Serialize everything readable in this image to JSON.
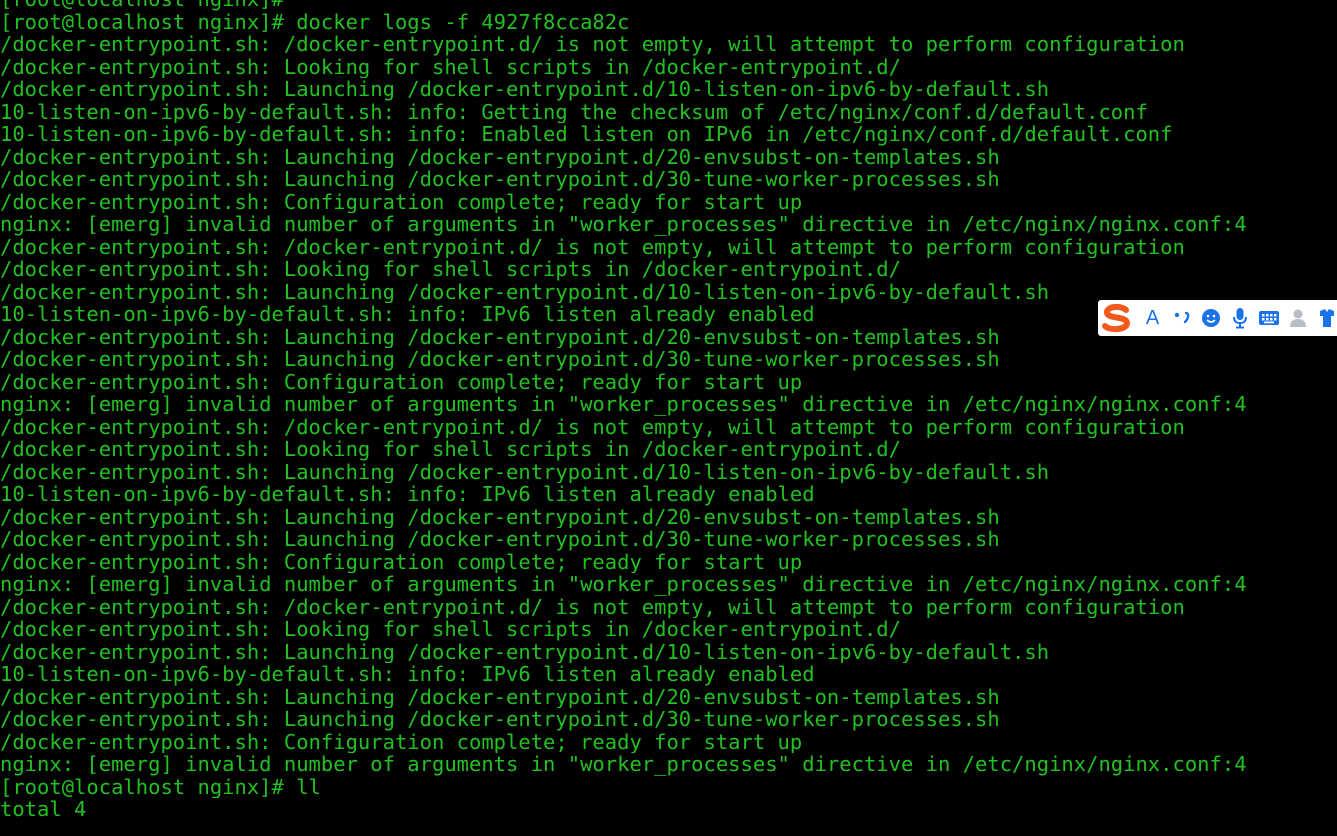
{
  "terminal": {
    "text_color": "#22c022",
    "background_color": "#000000",
    "lines": [
      "[root@localhost nginx]#",
      "[root@localhost nginx]# docker logs -f 4927f8cca82c",
      "/docker-entrypoint.sh: /docker-entrypoint.d/ is not empty, will attempt to perform configuration",
      "/docker-entrypoint.sh: Looking for shell scripts in /docker-entrypoint.d/",
      "/docker-entrypoint.sh: Launching /docker-entrypoint.d/10-listen-on-ipv6-by-default.sh",
      "10-listen-on-ipv6-by-default.sh: info: Getting the checksum of /etc/nginx/conf.d/default.conf",
      "10-listen-on-ipv6-by-default.sh: info: Enabled listen on IPv6 in /etc/nginx/conf.d/default.conf",
      "/docker-entrypoint.sh: Launching /docker-entrypoint.d/20-envsubst-on-templates.sh",
      "/docker-entrypoint.sh: Launching /docker-entrypoint.d/30-tune-worker-processes.sh",
      "/docker-entrypoint.sh: Configuration complete; ready for start up",
      "nginx: [emerg] invalid number of arguments in \"worker_processes\" directive in /etc/nginx/nginx.conf:4",
      "/docker-entrypoint.sh: /docker-entrypoint.d/ is not empty, will attempt to perform configuration",
      "/docker-entrypoint.sh: Looking for shell scripts in /docker-entrypoint.d/",
      "/docker-entrypoint.sh: Launching /docker-entrypoint.d/10-listen-on-ipv6-by-default.sh",
      "10-listen-on-ipv6-by-default.sh: info: IPv6 listen already enabled",
      "/docker-entrypoint.sh: Launching /docker-entrypoint.d/20-envsubst-on-templates.sh",
      "/docker-entrypoint.sh: Launching /docker-entrypoint.d/30-tune-worker-processes.sh",
      "/docker-entrypoint.sh: Configuration complete; ready for start up",
      "nginx: [emerg] invalid number of arguments in \"worker_processes\" directive in /etc/nginx/nginx.conf:4",
      "/docker-entrypoint.sh: /docker-entrypoint.d/ is not empty, will attempt to perform configuration",
      "/docker-entrypoint.sh: Looking for shell scripts in /docker-entrypoint.d/",
      "/docker-entrypoint.sh: Launching /docker-entrypoint.d/10-listen-on-ipv6-by-default.sh",
      "10-listen-on-ipv6-by-default.sh: info: IPv6 listen already enabled",
      "/docker-entrypoint.sh: Launching /docker-entrypoint.d/20-envsubst-on-templates.sh",
      "/docker-entrypoint.sh: Launching /docker-entrypoint.d/30-tune-worker-processes.sh",
      "/docker-entrypoint.sh: Configuration complete; ready for start up",
      "nginx: [emerg] invalid number of arguments in \"worker_processes\" directive in /etc/nginx/nginx.conf:4",
      "/docker-entrypoint.sh: /docker-entrypoint.d/ is not empty, will attempt to perform configuration",
      "/docker-entrypoint.sh: Looking for shell scripts in /docker-entrypoint.d/",
      "/docker-entrypoint.sh: Launching /docker-entrypoint.d/10-listen-on-ipv6-by-default.sh",
      "10-listen-on-ipv6-by-default.sh: info: IPv6 listen already enabled",
      "/docker-entrypoint.sh: Launching /docker-entrypoint.d/20-envsubst-on-templates.sh",
      "/docker-entrypoint.sh: Launching /docker-entrypoint.d/30-tune-worker-processes.sh",
      "/docker-entrypoint.sh: Configuration complete; ready for start up",
      "nginx: [emerg] invalid number of arguments in \"worker_processes\" directive in /etc/nginx/nginx.conf:4",
      "[root@localhost nginx]# ll",
      "total 4"
    ]
  },
  "ime_toolbar": {
    "logo_icon": "sogou-s-logo-icon",
    "logo_color": "#f2591c",
    "mode_label": "A",
    "icon_color": "#1a73e8",
    "buttons": [
      {
        "name": "punctuation-icon"
      },
      {
        "name": "emoji-icon"
      },
      {
        "name": "voice-input-icon"
      },
      {
        "name": "soft-keyboard-icon"
      },
      {
        "name": "user-account-icon"
      },
      {
        "name": "skin-toolbox-icon"
      }
    ]
  }
}
